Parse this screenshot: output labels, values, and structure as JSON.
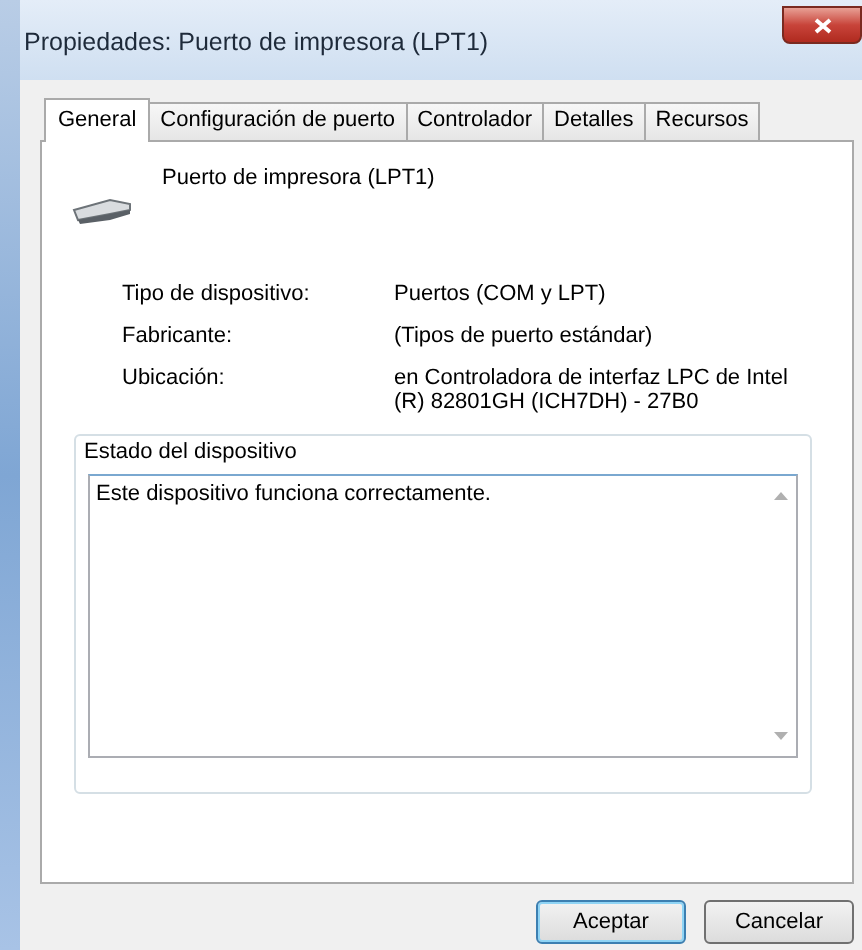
{
  "window": {
    "title": "Propiedades: Puerto de impresora (LPT1)"
  },
  "tabs": [
    {
      "label": "General",
      "selected": true
    },
    {
      "label": "Configuración de puerto",
      "selected": false
    },
    {
      "label": "Controlador",
      "selected": false
    },
    {
      "label": "Detalles",
      "selected": false
    },
    {
      "label": "Recursos",
      "selected": false
    }
  ],
  "device": {
    "name": "Puerto de impresora (LPT1)"
  },
  "properties": [
    {
      "label": "Tipo de dispositivo:",
      "value": "Puertos (COM y LPT)"
    },
    {
      "label": "Fabricante:",
      "value": "(Tipos de puerto estándar)"
    },
    {
      "label": "Ubicación:",
      "value": "en Controladora de interfaz LPC de Intel (R) 82801GH (ICH7DH) - 27B0"
    }
  ],
  "status_group": {
    "title": "Estado del dispositivo",
    "text": "Este dispositivo funciona correctamente."
  },
  "buttons": [
    {
      "label": "Aceptar",
      "default": true
    },
    {
      "label": "Cancelar",
      "default": false
    }
  ]
}
